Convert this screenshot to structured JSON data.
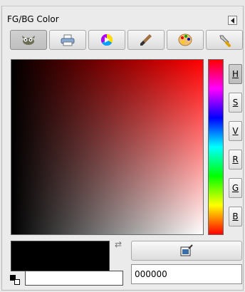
{
  "title": "FG/BG Color",
  "tabs": [
    {
      "name": "gimp-selector",
      "icon": "wilber-icon",
      "active": true
    },
    {
      "name": "cmyk-selector",
      "icon": "printer-icon",
      "active": false
    },
    {
      "name": "wheel-selector",
      "icon": "color-wheel-icon",
      "active": false
    },
    {
      "name": "watercolor-selector",
      "icon": "brush-icon",
      "active": false
    },
    {
      "name": "palette-selector",
      "icon": "palette-icon",
      "active": false
    },
    {
      "name": "scales-selector",
      "icon": "wrench-icon",
      "active": false
    }
  ],
  "channels": [
    {
      "label": "H",
      "active": true
    },
    {
      "label": "S",
      "active": false
    },
    {
      "label": "V",
      "active": false
    },
    {
      "label": "R",
      "active": false
    },
    {
      "label": "G",
      "active": false
    },
    {
      "label": "B",
      "active": false
    }
  ],
  "foreground_color": "#000000",
  "background_color": "#ffffff",
  "hex_value": "000000"
}
